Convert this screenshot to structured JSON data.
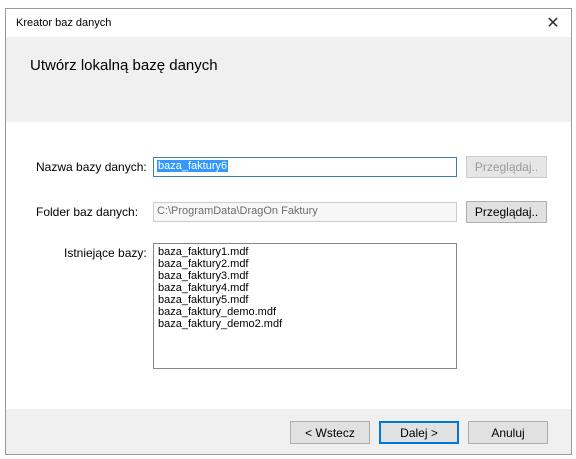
{
  "window": {
    "title": "Kreator baz danych",
    "close_glyph": "✕"
  },
  "header": {
    "heading": "Utwórz lokalną bazę danych"
  },
  "form": {
    "db_name_label": "Nazwa bazy danych:",
    "db_name_value": "baza_faktury6",
    "browse1_label": "Przeglądaj..",
    "folder_label": "Folder baz danych:",
    "folder_value": "C:\\ProgramData\\DragOn Faktury",
    "browse2_label": "Przeglądaj..",
    "existing_label": "Istniejące bazy:",
    "existing": [
      "baza_faktury1.mdf",
      "baza_faktury2.mdf",
      "baza_faktury3.mdf",
      "baza_faktury4.mdf",
      "baza_faktury5.mdf",
      "baza_faktury_demo.mdf",
      "baza_faktury_demo2.mdf"
    ]
  },
  "footer": {
    "back_label": "< Wstecz",
    "next_label": "Dalej >",
    "cancel_label": "Anuluj"
  }
}
